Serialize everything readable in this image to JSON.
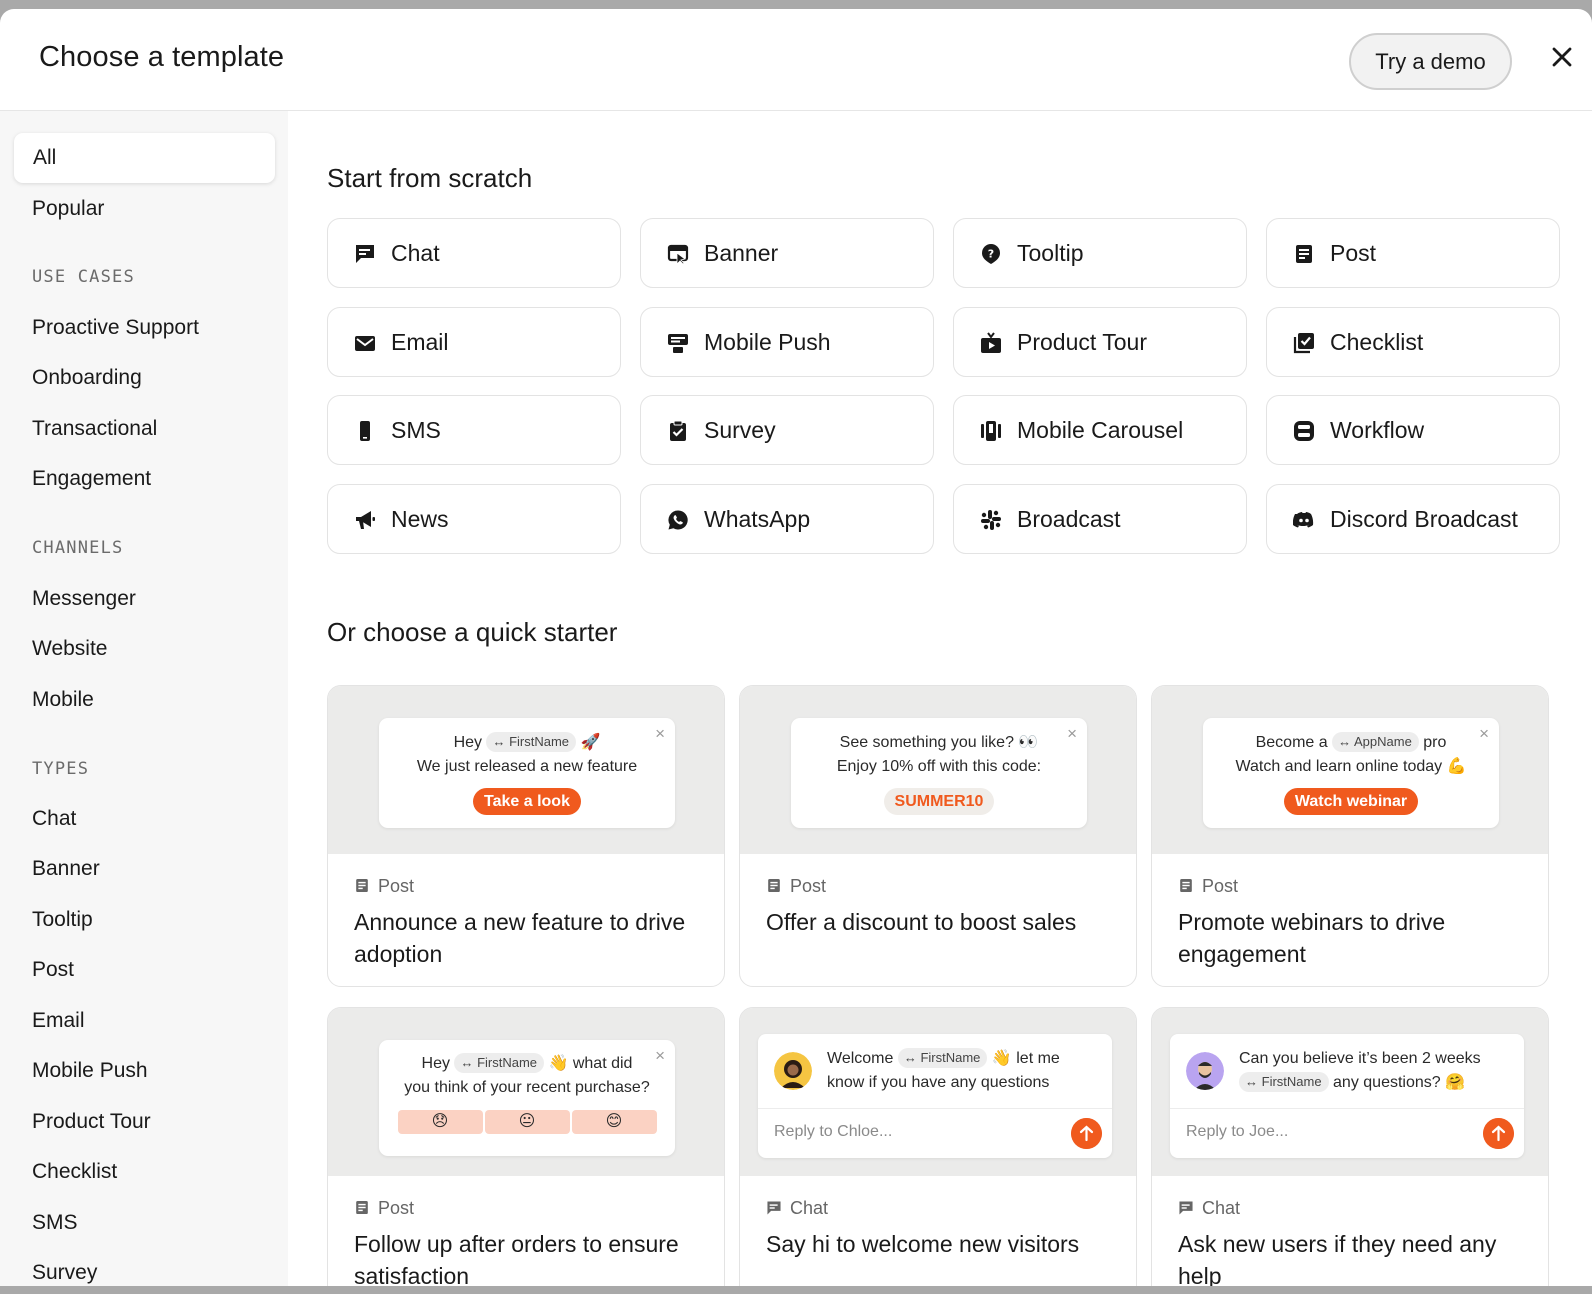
{
  "header": {
    "title": "Choose a template",
    "demo_label": "Try a demo"
  },
  "sidebar": {
    "top_items": [
      "All",
      "Popular"
    ],
    "use_cases_heading": "USE CASES",
    "use_cases": [
      "Proactive Support",
      "Onboarding",
      "Transactional",
      "Engagement"
    ],
    "channels_heading": "CHANNELS",
    "channels": [
      "Messenger",
      "Website",
      "Mobile"
    ],
    "types_heading": "TYPES",
    "types": [
      "Chat",
      "Banner",
      "Tooltip",
      "Post",
      "Email",
      "Mobile Push",
      "Product Tour",
      "Checklist",
      "SMS",
      "Survey"
    ]
  },
  "scratch": {
    "title": "Start from scratch",
    "tiles": [
      {
        "label": "Chat",
        "icon": "chat-icon"
      },
      {
        "label": "Banner",
        "icon": "banner-icon"
      },
      {
        "label": "Tooltip",
        "icon": "tooltip-icon"
      },
      {
        "label": "Post",
        "icon": "post-icon"
      },
      {
        "label": "Email",
        "icon": "email-icon"
      },
      {
        "label": "Mobile Push",
        "icon": "mobile-push-icon"
      },
      {
        "label": "Product Tour",
        "icon": "product-tour-icon"
      },
      {
        "label": "Checklist",
        "icon": "checklist-icon"
      },
      {
        "label": "SMS",
        "icon": "sms-icon"
      },
      {
        "label": "Survey",
        "icon": "survey-icon"
      },
      {
        "label": "Mobile Carousel",
        "icon": "mobile-carousel-icon"
      },
      {
        "label": "Workflow",
        "icon": "workflow-icon"
      },
      {
        "label": "News",
        "icon": "megaphone-icon"
      },
      {
        "label": "WhatsApp",
        "icon": "whatsapp-icon"
      },
      {
        "label": "Broadcast",
        "icon": "slack-icon"
      },
      {
        "label": "Discord Broadcast",
        "icon": "discord-icon"
      }
    ]
  },
  "starters": {
    "title": "Or choose a quick starter",
    "cards": [
      {
        "type": "Post",
        "title": "Announce a new feature to drive adoption",
        "preview": {
          "hey": "Hey",
          "chip": "FirstName",
          "emoji": "🚀",
          "line2": "We just released a new feature",
          "button": "Take a look"
        }
      },
      {
        "type": "Post",
        "title": "Offer a discount to boost sales",
        "preview": {
          "line1": "See something you like? 👀",
          "line2": "Enjoy 10% off with this code:",
          "code": "SUMMER10"
        }
      },
      {
        "type": "Post",
        "title": "Promote webinars to drive engagement",
        "preview": {
          "pre": "Become a",
          "chip": "AppName",
          "post": "pro",
          "line2": "Watch and learn online today 💪",
          "button": "Watch webinar"
        }
      },
      {
        "type": "Post",
        "title": "Follow up after orders to ensure satisfaction",
        "preview": {
          "hey": "Hey",
          "chip": "FirstName",
          "post": "👋 what did",
          "line2": "you think of your recent purchase?",
          "emojis": [
            "😞",
            "😐",
            "😊"
          ]
        }
      },
      {
        "type": "Chat",
        "title": "Say hi to welcome new visitors",
        "preview": {
          "pre": "Welcome",
          "chip": "FirstName",
          "post": "👋 let me",
          "line2": "know if you have any questions",
          "reply": "Reply to Chloe..."
        }
      },
      {
        "type": "Chat",
        "title": "Ask new users if they need any help",
        "preview": {
          "line1": "Can you believe it’s been 2 weeks",
          "chip": "FirstName",
          "post": "any questions? 🤗",
          "reply": "Reply to Joe..."
        }
      }
    ]
  },
  "colors": {
    "accent": "#f05a1e",
    "sidebar_bg": "#f7f7f7",
    "preview_bg": "#ebebea"
  }
}
